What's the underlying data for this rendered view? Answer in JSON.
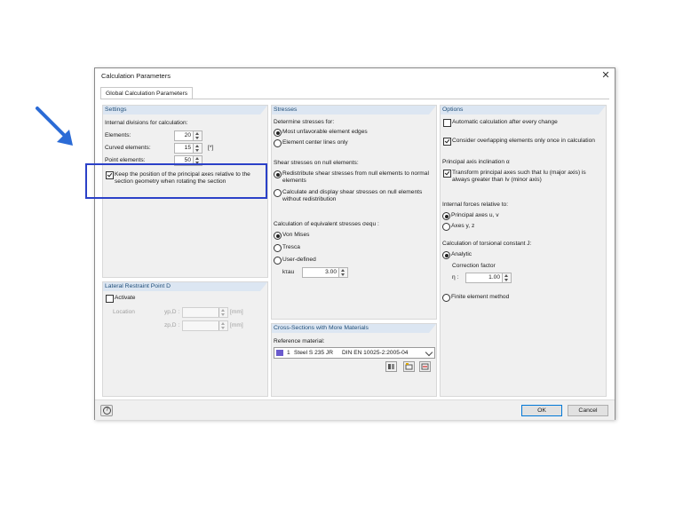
{
  "window": {
    "title": "Calculation Parameters",
    "close_glyph": "✕"
  },
  "tab": {
    "label": "Global Calculation Parameters"
  },
  "settings": {
    "header": "Settings",
    "internal_divisions_label": "Internal divisions for calculation:",
    "elements_label": "Elements:",
    "elements_value": "20",
    "curved_label": "Curved elements:",
    "curved_value": "15",
    "curved_unit": "[*]",
    "point_label": "Point elements:",
    "point_value": "50",
    "keep_position_line1": "Keep the position of the principal axes relative to the",
    "keep_position_line2": "section geometry when rotating the section",
    "keep_position_checked": true
  },
  "lateral": {
    "header": "Lateral Restraint Point D",
    "activate_label": "Activate",
    "location_label": "Location",
    "yp_label": "yp,D :",
    "yp_unit": "[mm]",
    "zp_label": "zp,D :",
    "zp_unit": "[mm]"
  },
  "stresses": {
    "header": "Stresses",
    "determine_label": "Determine stresses for:",
    "opt_most": "Most unfavorable element edges",
    "opt_center": "Element center lines only",
    "shear_null_label": "Shear stresses on null elements:",
    "opt_redistribute_1": "Redistribute shear stresses from null elements to normal",
    "opt_redistribute_2": "elements",
    "opt_calc_display_1": "Calculate and display shear stresses on null elements",
    "opt_calc_display_2": "without redistribution",
    "equiv_label": "Calculation of equivalent stresses σequ :",
    "opt_von_mises": "Von Mises",
    "opt_tresca": "Tresca",
    "opt_user": "User-defined",
    "ktau_label": "kτau",
    "ktau_value": "3.00"
  },
  "cross_sections": {
    "header": "Cross-Sections with More Materials",
    "reference_label": "Reference material:",
    "material_number": "1",
    "material_name": "Steel S 235 JR",
    "material_standard": "DIN EN 10025-2:2005-04",
    "material_color": "#6a5acd"
  },
  "options": {
    "header": "Options",
    "auto_calc": "Automatic calculation after every change",
    "auto_calc_checked": false,
    "overlap": "Consider overlapping elements only once in calculation",
    "overlap_checked": true,
    "principal_label": "Principal axis inclination α",
    "transform_1": "Transform principal axes such that Iu (major axis) is",
    "transform_2": "always greater than Iv (minor axis)",
    "transform_checked": true,
    "internal_forces_label": "Internal forces relative to:",
    "opt_principal_axes": "Principal axes u, v",
    "opt_axes_yz": "Axes y, z",
    "torsion_label": "Calculation of torsional constant J:",
    "opt_analytic": "Analytic",
    "correction_label": "Correction factor",
    "eta_label": "η :",
    "eta_value": "1.00",
    "opt_fem": "Finite element method"
  },
  "footer": {
    "ok": "OK",
    "cancel": "Cancel",
    "help_glyph": "?"
  },
  "colors": {
    "highlight": "#2b41c8",
    "arrow": "#2b6bd6",
    "panel_header": "#dce6f2"
  }
}
